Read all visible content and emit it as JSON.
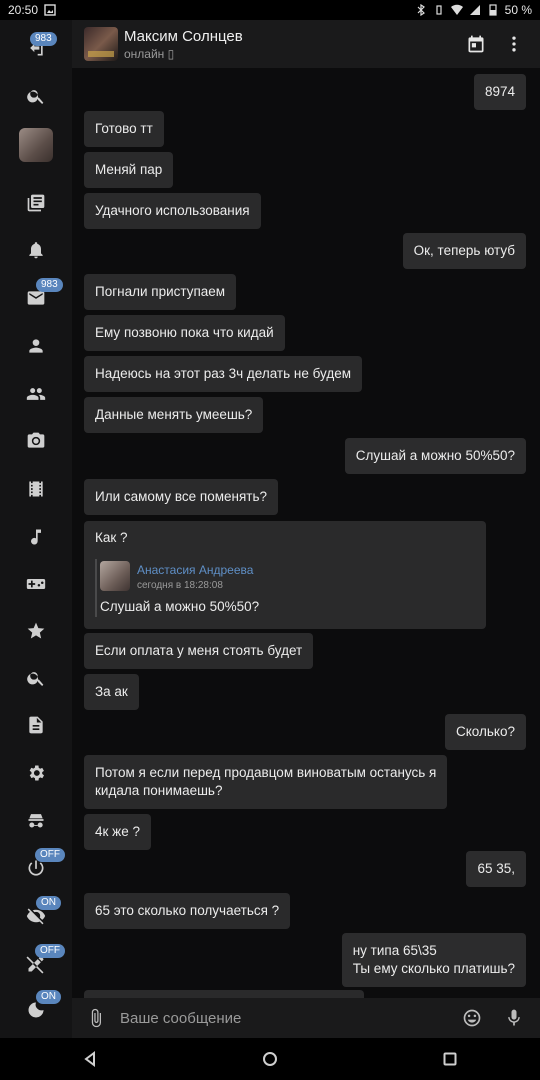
{
  "statusbar": {
    "time": "20:50",
    "battery": "50 %"
  },
  "sidebar": {
    "back_badge": "983",
    "messages_badge": "983",
    "toggles": [
      "OFF",
      "ON",
      "OFF",
      "ON"
    ]
  },
  "header": {
    "title": "Максим Солнцев",
    "status": "онлайн ▯"
  },
  "messages": [
    {
      "text": "8974",
      "dir": "out"
    },
    {
      "text": "Готово тт",
      "dir": "in"
    },
    {
      "text": "Меняй пар",
      "dir": "in"
    },
    {
      "text": "Удачного использования",
      "dir": "in"
    },
    {
      "text": "Ок, теперь ютуб",
      "dir": "out"
    },
    {
      "text": "Погнали приступаем",
      "dir": "in"
    },
    {
      "text": "Ему позвоню пока что кидай",
      "dir": "in"
    },
    {
      "text": "Надеюсь на этот раз 3ч делать не будем",
      "dir": "in"
    },
    {
      "text": "Данные менять умеешь?",
      "dir": "in"
    },
    {
      "text": "Слушай а можно 50%50?",
      "dir": "out"
    },
    {
      "text": "Или самому все поменять?",
      "dir": "in"
    },
    {
      "text": "Если оплата у меня стоять будет",
      "dir": "in"
    },
    {
      "text": "За ак",
      "dir": "in"
    },
    {
      "text": "Сколько?",
      "dir": "out"
    },
    {
      "text": "Потом я если перед продавцом виноватым останусь я\nкидала понимаешь?",
      "dir": "in"
    },
    {
      "text": "4к же ?",
      "dir": "in"
    },
    {
      "text": "65 35,",
      "dir": "out"
    },
    {
      "text": "65 это сколько получаеться ?",
      "dir": "in"
    },
    {
      "text": "ну типа 65\\35\nТы ему сколько платишь?",
      "dir": "out"
    }
  ],
  "quote": {
    "text": "Как ?",
    "author": "Анастасия Андреева",
    "time": "сегодня в 18:28:08",
    "body": "Слушай а можно 50%50?"
  },
  "input": {
    "placeholder": "Ваше сообщение"
  }
}
